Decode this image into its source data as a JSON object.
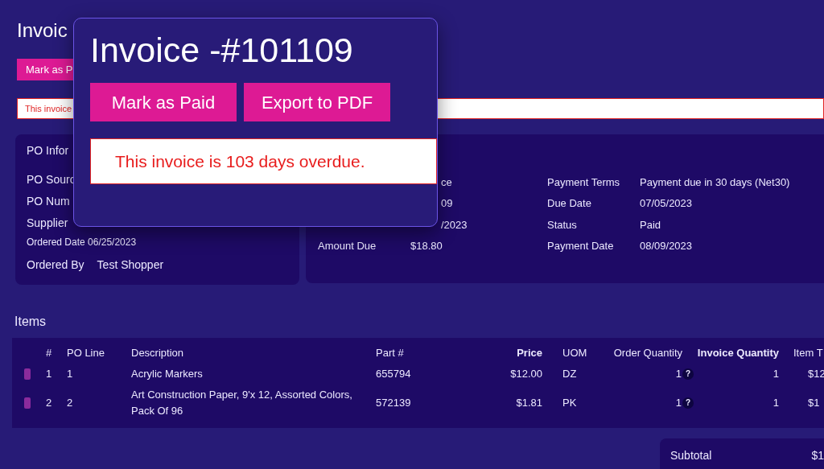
{
  "page": {
    "title": "Invoic",
    "button": "Mark as P",
    "alert": "This invoice"
  },
  "po_card": {
    "title": "PO Infor",
    "labels": [
      "PO Sourc",
      "PO Num",
      "Supplier"
    ],
    "ordered_date": "Ordered Date 06/25/2023",
    "ordered_by": {
      "label": "Ordered By",
      "value": "Test Shopper"
    }
  },
  "invoice_card": {
    "rows": [
      {
        "value": "ce",
        "label_2": "Payment Terms",
        "value_2": "Payment due in 30 days (Net30)"
      },
      {
        "value": "09",
        "label_2": "Due Date",
        "value_2": "07/05/2023"
      },
      {
        "value": "/2023",
        "label_2": "Status",
        "value_2": "Paid"
      },
      {
        "label": "Amount Due",
        "value": "$18.80",
        "label_2": "Payment Date",
        "value_2": "08/09/2023"
      }
    ]
  },
  "items": {
    "title": "Items",
    "columns": [
      {
        "label": "#",
        "highlighted": false
      },
      {
        "label": "PO Line",
        "highlighted": false
      },
      {
        "label": "Description",
        "highlighted": false
      },
      {
        "label": "Part #",
        "highlighted": false
      },
      {
        "label": "Price",
        "highlighted": true
      },
      {
        "label": "UOM",
        "highlighted": false
      },
      {
        "label": "Order Quantity",
        "highlighted": false
      },
      {
        "label": "Invoice Quantity",
        "highlighted": true
      },
      {
        "label": "Item T",
        "highlighted": false
      }
    ],
    "rows": [
      {
        "cells": [
          "1",
          "1",
          "Acrylic Markers",
          "655794",
          "$12.00",
          "DZ",
          "1",
          "1",
          "$12"
        ],
        "help_mark": "?"
      },
      {
        "cells": [
          "2",
          "2",
          "Art Construction Paper, 9'x 12, Assorted Colors, Pack Of 96",
          "572139",
          "$1.81",
          "PK",
          "1",
          "1",
          "$1"
        ],
        "help_mark": "?"
      }
    ]
  },
  "totals": {
    "label": "Subtotal",
    "value": "$1"
  },
  "popup": {
    "title": "Invoice -#101109",
    "buttons": [
      "Mark as Paid",
      "Export to PDF"
    ],
    "alert": "This invoice is 103 days overdue."
  }
}
